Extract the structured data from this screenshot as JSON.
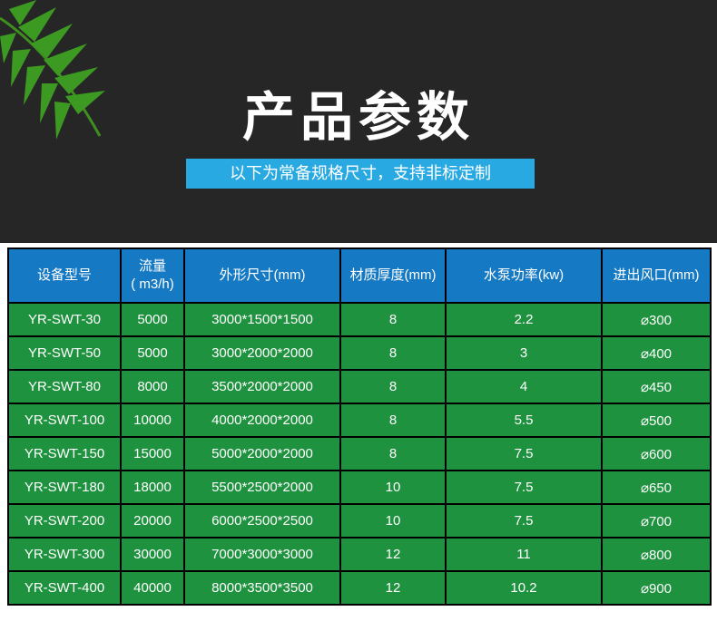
{
  "header": {
    "title": "产品参数",
    "subtitle": "以下为常备规格尺寸，支持非标定制"
  },
  "table": {
    "columns": [
      "设备型号",
      "流量\n( m3/h)",
      "外形尺寸(mm)",
      "材质厚度(mm)",
      "水泵功率(kw)",
      "进出风口(mm)"
    ],
    "rows": [
      [
        "YR-SWT-30",
        "5000",
        "3000*1500*1500",
        "8",
        "2.2",
        "⌀300"
      ],
      [
        "YR-SWT-50",
        "5000",
        "3000*2000*2000",
        "8",
        "3",
        "⌀400"
      ],
      [
        "YR-SWT-80",
        "8000",
        "3500*2000*2000",
        "8",
        "4",
        "⌀450"
      ],
      [
        "YR-SWT-100",
        "10000",
        "4000*2000*2000",
        "8",
        "5.5",
        "⌀500"
      ],
      [
        "YR-SWT-150",
        "15000",
        "5000*2000*2000",
        "8",
        "7.5",
        "⌀600"
      ],
      [
        "YR-SWT-180",
        "18000",
        "5500*2500*2000",
        "10",
        "7.5",
        "⌀650"
      ],
      [
        "YR-SWT-200",
        "20000",
        "6000*2500*2500",
        "10",
        "7.5",
        "⌀700"
      ],
      [
        "YR-SWT-300",
        "30000",
        "7000*3000*3000",
        "12",
        "11",
        "⌀800"
      ],
      [
        "YR-SWT-400",
        "40000",
        "8000*3500*3500",
        "12",
        "10.2",
        "⌀900"
      ]
    ]
  },
  "colors": {
    "header_bg": "#262626",
    "subtitle_bg": "#28a9e2",
    "table_header_bg": "#1579c4",
    "table_row_bg": "#1e923e"
  },
  "icons": [
    "palm-leaf-icon"
  ]
}
